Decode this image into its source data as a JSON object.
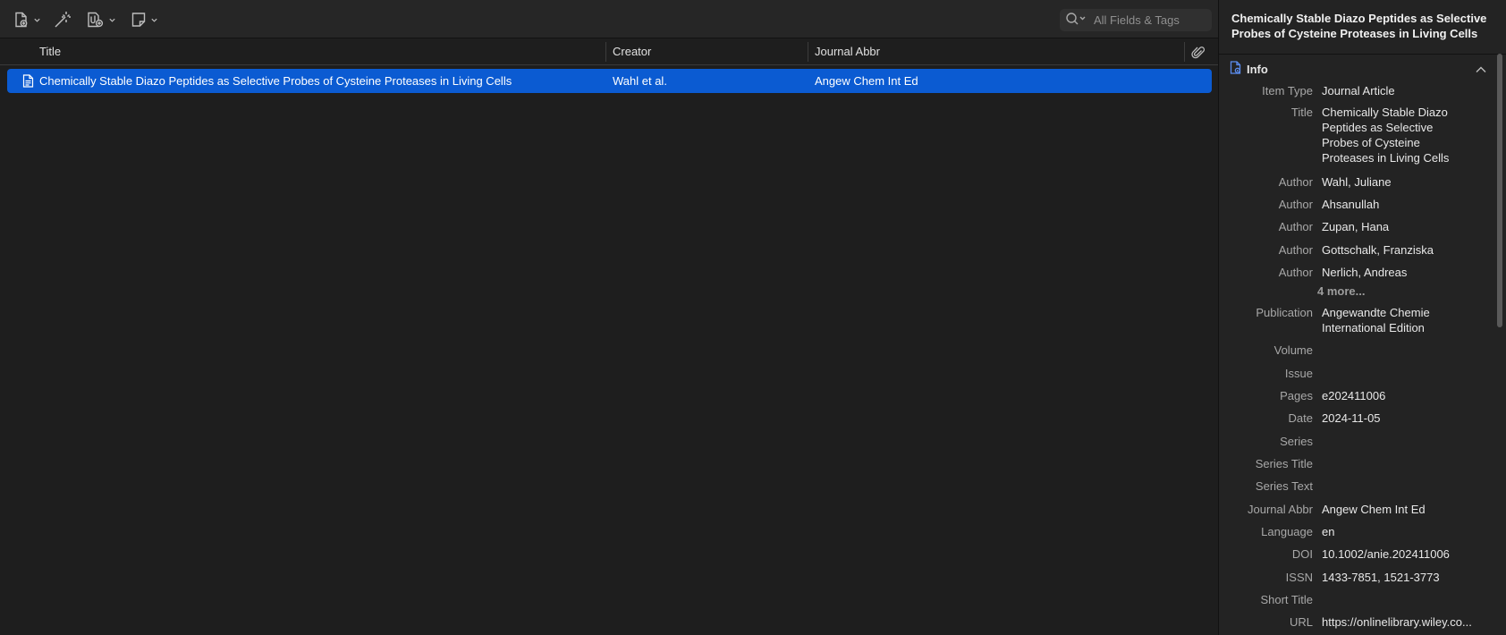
{
  "toolbar": {
    "search_placeholder": "All Fields & Tags"
  },
  "columns": {
    "title": "Title",
    "creator": "Creator",
    "journal_abbr": "Journal Abbr"
  },
  "items": [
    {
      "title": "Chemically Stable Diazo Peptides as Selective Probes of Cysteine Proteases in Living Cells",
      "creator": "Wahl et al.",
      "journal_abbr": "Angew Chem Int Ed"
    }
  ],
  "detail": {
    "header_title": "Chemically Stable Diazo Peptides as Selective Probes of Cysteine Proteases in Living Cells",
    "section_label": "Info",
    "more_authors": "4 more...",
    "fields": [
      {
        "label": "Item Type",
        "value": "Journal Article"
      },
      {
        "label": "Title",
        "value": "Chemically Stable Diazo Peptides as Selective Probes of Cysteine Proteases in Living Cells"
      },
      {
        "label": "Author",
        "value": "Wahl, Juliane"
      },
      {
        "label": "Author",
        "value": "Ahsanullah"
      },
      {
        "label": "Author",
        "value": "Zupan, Hana"
      },
      {
        "label": "Author",
        "value": "Gottschalk, Franziska"
      },
      {
        "label": "Author",
        "value": "Nerlich, Andreas"
      },
      {
        "label": "Publication",
        "value": "Angewandte Chemie International Edition"
      },
      {
        "label": "Volume",
        "value": ""
      },
      {
        "label": "Issue",
        "value": ""
      },
      {
        "label": "Pages",
        "value": "e202411006"
      },
      {
        "label": "Date",
        "value": "2024-11-05"
      },
      {
        "label": "Series",
        "value": ""
      },
      {
        "label": "Series Title",
        "value": ""
      },
      {
        "label": "Series Text",
        "value": ""
      },
      {
        "label": "Journal Abbr",
        "value": "Angew Chem Int Ed"
      },
      {
        "label": "Language",
        "value": "en"
      },
      {
        "label": "DOI",
        "value": "10.1002/anie.202411006"
      },
      {
        "label": "ISSN",
        "value": "1433-7851, 1521-3773"
      },
      {
        "label": "Short Title",
        "value": ""
      },
      {
        "label": "URL",
        "value": "https://onlinelibrary.wiley.co..."
      }
    ]
  },
  "icons": {
    "new_item": "new-item-icon",
    "magic_wand": "magic-wand-icon",
    "attachment": "add-attachment-icon",
    "note": "new-note-icon",
    "search": "search-icon",
    "paperclip": "paperclip-icon",
    "document": "document-icon",
    "info": "info-icon",
    "collapse": "chevron-up-icon"
  },
  "colors": {
    "selection": "#0b5bd2",
    "accent_icon": "#5b8def"
  }
}
